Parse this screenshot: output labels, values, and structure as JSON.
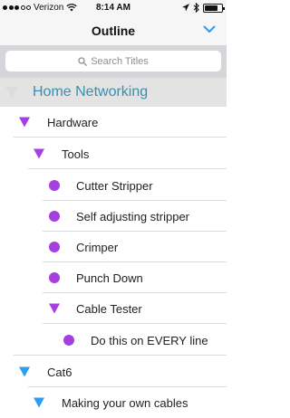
{
  "status_bar": {
    "carrier": "Verizon",
    "time": "8:14 AM",
    "signal_bars_filled": 3,
    "signal_bars_total": 5,
    "battery_level": 0.8,
    "icons": [
      "wifi-icon",
      "location-icon",
      "bluetooth-icon",
      "battery-icon"
    ]
  },
  "nav": {
    "title": "Outline",
    "right_icon": "chevron-down-icon",
    "accent_color": "#2f9df2"
  },
  "search": {
    "placeholder": "Search Titles"
  },
  "outline": {
    "rows": [
      {
        "label": "Home Networking",
        "level": 0,
        "marker": "triangle-gray"
      },
      {
        "label": "Hardware",
        "level": 1,
        "marker": "triangle-purple"
      },
      {
        "label": "Tools",
        "level": 2,
        "marker": "triangle-purple"
      },
      {
        "label": "Cutter Stripper",
        "level": 3,
        "marker": "dot-purple"
      },
      {
        "label": "Self adjusting stripper",
        "level": 3,
        "marker": "dot-purple"
      },
      {
        "label": "Crimper",
        "level": 3,
        "marker": "dot-purple"
      },
      {
        "label": "Punch Down",
        "level": 3,
        "marker": "dot-purple"
      },
      {
        "label": "Cable Tester",
        "level": 3,
        "marker": "triangle-purple"
      },
      {
        "label": "Do this on EVERY line",
        "level": 4,
        "marker": "dot-purple"
      },
      {
        "label": "Cat6",
        "level": 1,
        "marker": "triangle-blue"
      },
      {
        "label": "Making your own cables",
        "level": 2,
        "marker": "triangle-blue"
      }
    ],
    "colors": {
      "purple": "#a63fe0",
      "blue": "#2f9df2",
      "root_text": "#3a8fb0"
    }
  }
}
